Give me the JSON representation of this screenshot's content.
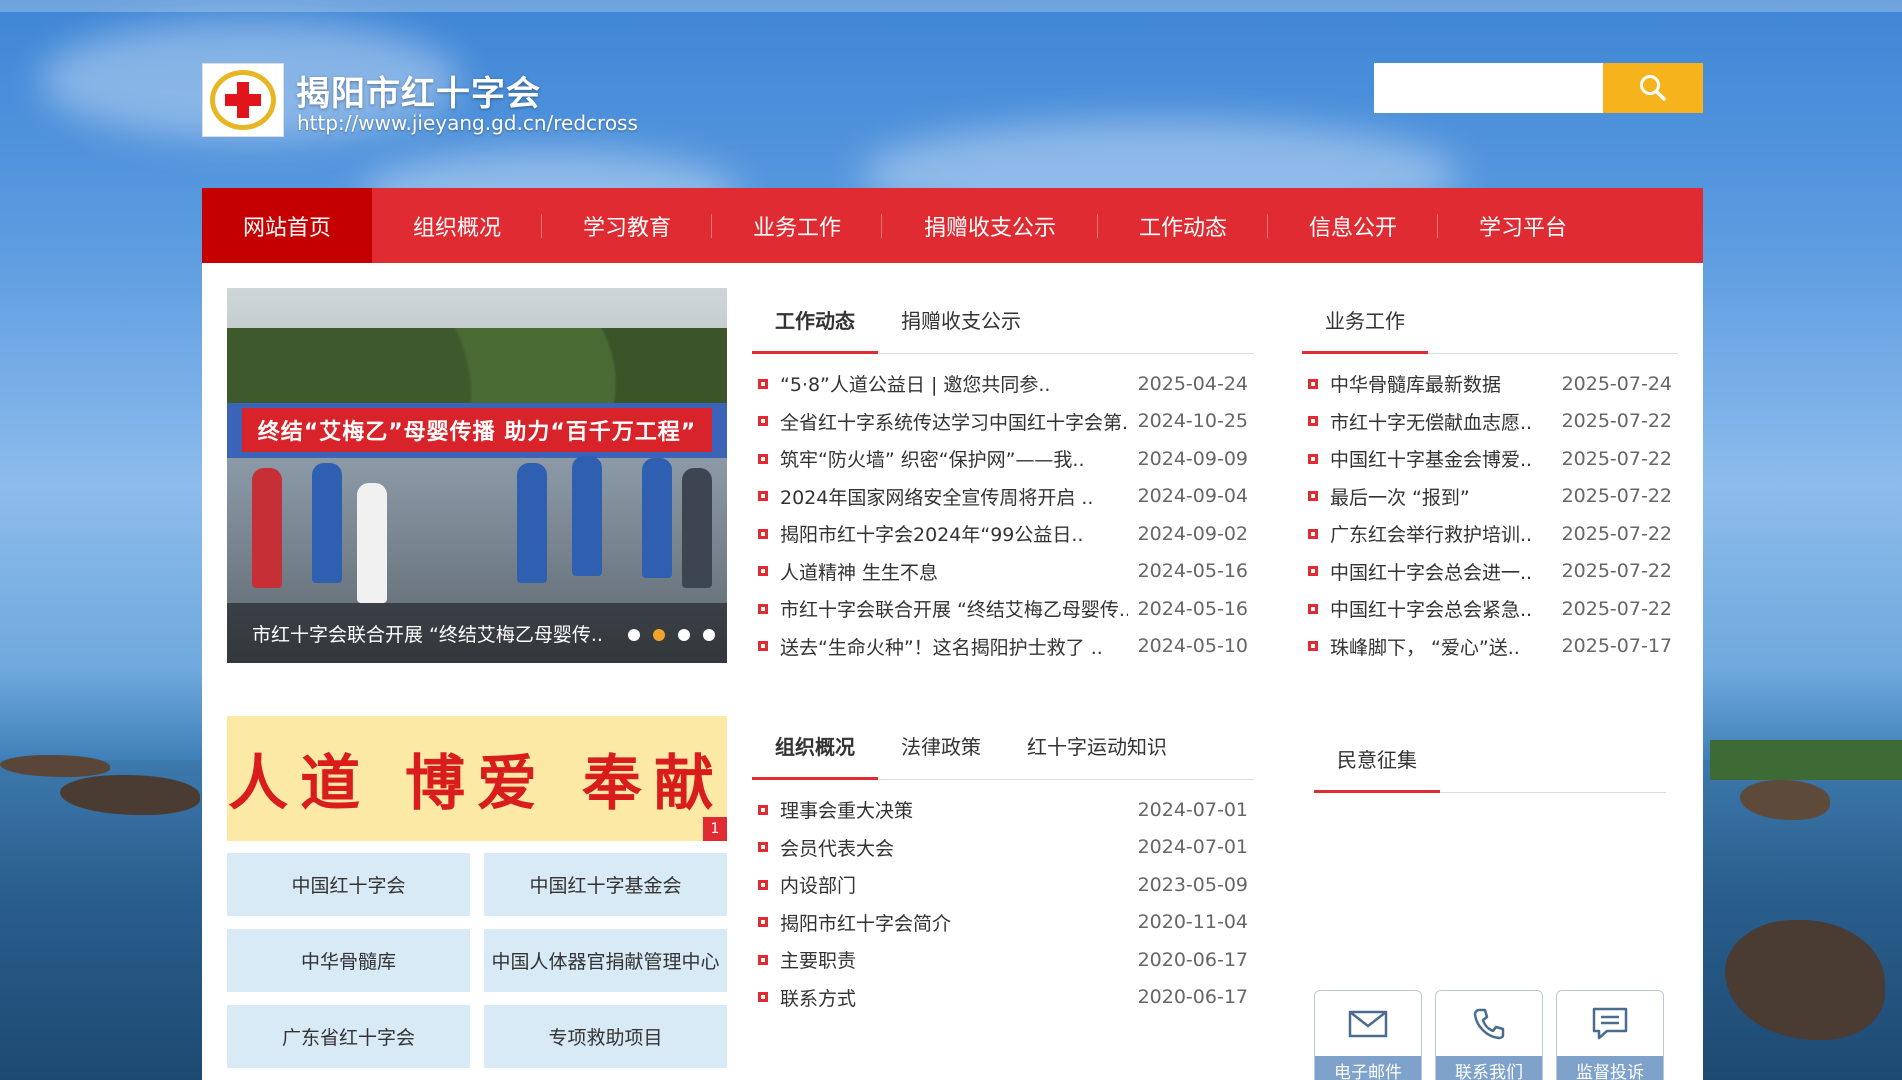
{
  "header": {
    "site_title": "揭阳市红十字会",
    "site_url": "http://www.jieyang.gd.cn/redcross",
    "search_placeholder": ""
  },
  "nav": {
    "items": [
      {
        "label": "网站首页",
        "active": true
      },
      {
        "label": "组织概况"
      },
      {
        "label": "学习教育"
      },
      {
        "label": "业务工作"
      },
      {
        "label": "捐赠收支公示"
      },
      {
        "label": "工作动态"
      },
      {
        "label": "信息公开"
      },
      {
        "label": "学习平台"
      }
    ]
  },
  "slider": {
    "banner_text": "终结“艾梅乙”母婴传播 助力“百千万工程”",
    "caption": "市红十字会联合开展 “终结艾梅乙母婴传..",
    "active_dot": 1,
    "dot_count": 4
  },
  "banner": {
    "text": "人道 博爱 奉献",
    "badge": "1"
  },
  "quick_links": [
    "中国红十字会",
    "中国红十字基金会",
    "中华骨髓库",
    "中国人体器官捐献管理中心",
    "广东省红十字会",
    "专项救助项目"
  ],
  "news_box": {
    "tabs": [
      "工作动态",
      "捐赠收支公示"
    ],
    "items": [
      {
        "title": "“5·8”人道公益日 | 邀您共同参..",
        "date": "2025-04-24"
      },
      {
        "title": "全省红十字系统传达学习中国红十字会第..",
        "date": "2024-10-25"
      },
      {
        "title": "筑牢“防火墙” 织密“保护网”——我..",
        "date": "2024-09-09"
      },
      {
        "title": "2024年国家网络安全宣传周将开启 ..",
        "date": "2024-09-04"
      },
      {
        "title": "揭阳市红十字会2024年“99公益日..",
        "date": "2024-09-02"
      },
      {
        "title": "人道精神 生生不息",
        "date": "2024-05-16"
      },
      {
        "title": "市红十字会联合开展 “终结艾梅乙母婴传..",
        "date": "2024-05-16"
      },
      {
        "title": "送去“生命火种”！这名揭阳护士救了 ..",
        "date": "2024-05-10"
      }
    ]
  },
  "business_box": {
    "tabs": [
      "业务工作"
    ],
    "items": [
      {
        "title": "中华骨髓库最新数据",
        "date": "2025-07-24"
      },
      {
        "title": "市红十字无偿献血志愿..",
        "date": "2025-07-22"
      },
      {
        "title": "中国红十字基金会博爱..",
        "date": "2025-07-22"
      },
      {
        "title": "最后一次 “报到”",
        "date": "2025-07-22"
      },
      {
        "title": "广东红会举行救护培训..",
        "date": "2025-07-22"
      },
      {
        "title": "中国红十字会总会进一..",
        "date": "2025-07-22"
      },
      {
        "title": "中国红十字会总会紧急..",
        "date": "2025-07-22"
      },
      {
        "title": "珠峰脚下， “爱心”送..",
        "date": "2025-07-17"
      }
    ]
  },
  "org_box": {
    "tabs": [
      "组织概况",
      "法律政策",
      "红十字运动知识"
    ],
    "items": [
      {
        "title": "理事会重大决策",
        "date": "2024-07-01"
      },
      {
        "title": "会员代表大会",
        "date": "2024-07-01"
      },
      {
        "title": "内设部门",
        "date": "2023-05-09"
      },
      {
        "title": "揭阳市红十字会简介",
        "date": "2020-11-04"
      },
      {
        "title": "主要职责",
        "date": "2020-06-17"
      },
      {
        "title": "联系方式",
        "date": "2020-06-17"
      }
    ]
  },
  "opinion_box": {
    "tabs": [
      "民意征集"
    ]
  },
  "contact_buttons": [
    {
      "label": "电子邮件",
      "icon": "envelope-icon"
    },
    {
      "label": "联系我们",
      "icon": "phone-icon"
    },
    {
      "label": "监督投诉",
      "icon": "message-icon"
    }
  ],
  "colors": {
    "brand_red": "#e02b32",
    "nav_active": "#c40000",
    "search_button": "#f6b31c",
    "quick_link_bg": "#d8eaf5"
  }
}
